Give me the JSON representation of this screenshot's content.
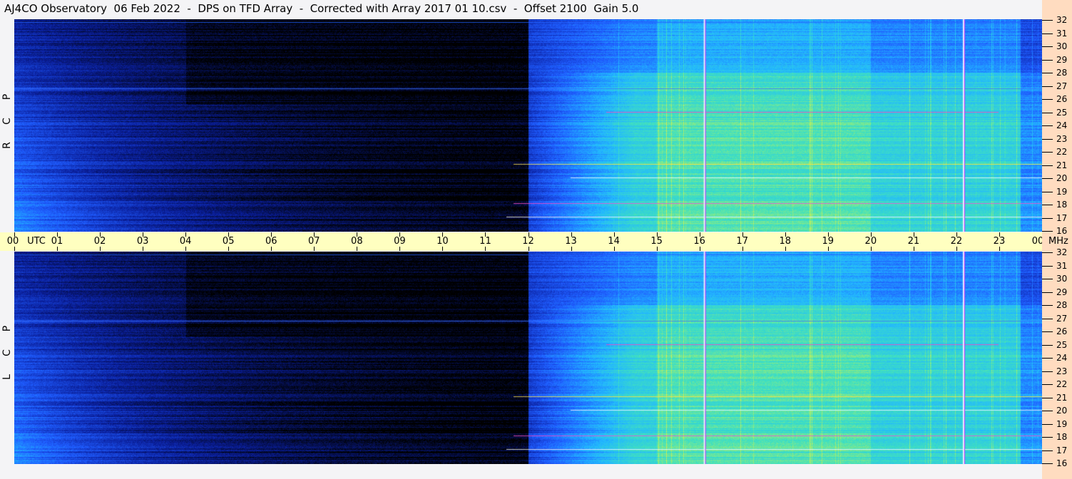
{
  "title": "AJ4CO Observatory  06 Feb 2022  -  DPS on TFD Array  -  Corrected with Array 2017 01 10.csv  -  Offset 2100  Gain 5.0",
  "chart_data": {
    "type": "heatmap",
    "title": "AJ4CO Observatory  06 Feb 2022  -  DPS on TFD Array  -  Corrected with Array 2017 01 10.csv  -  Offset 2100  Gain 5.0",
    "panels": [
      {
        "name": "R C P",
        "letters": [
          "R",
          "C",
          "P"
        ]
      },
      {
        "name": "L C P",
        "letters": [
          "L",
          "C",
          "P"
        ]
      }
    ],
    "x_axis": {
      "label": "UTC",
      "ticks": [
        "00",
        "01",
        "02",
        "03",
        "04",
        "05",
        "06",
        "07",
        "08",
        "09",
        "10",
        "11",
        "12",
        "13",
        "14",
        "15",
        "16",
        "17",
        "18",
        "19",
        "20",
        "21",
        "22",
        "23",
        "00"
      ],
      "xlim": [
        0,
        24
      ]
    },
    "y_axis": {
      "unit": "MHz",
      "ticks": [
        16,
        17,
        18,
        19,
        20,
        21,
        22,
        23,
        24,
        25,
        26,
        27,
        28,
        29,
        30,
        31,
        32
      ],
      "ylim": [
        16,
        32
      ]
    },
    "colormap": [
      "#000000",
      "#0a1e9a",
      "#1f5cff",
      "#22b8ff",
      "#3fe0c0",
      "#b8f060",
      "#ffe040",
      "#ff40c0",
      "#ffffff"
    ],
    "markers_utc": [
      16.1,
      22.15
    ],
    "grid": false
  },
  "colors": {
    "time_axis_bg": "#ffffc0",
    "freq_axis_bg": "#ffdcc0",
    "page_bg": "#f4f4f6"
  }
}
